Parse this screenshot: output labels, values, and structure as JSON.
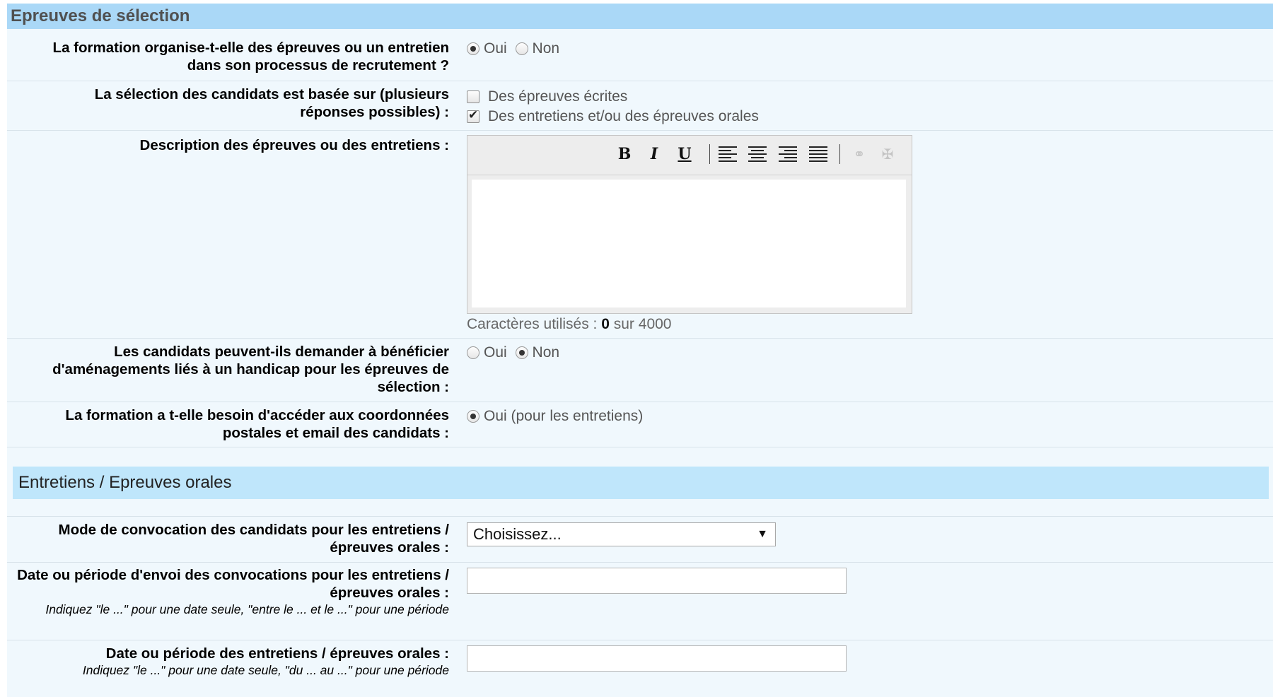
{
  "section": {
    "title": "Epreuves de sélection"
  },
  "q1": {
    "label": "La formation organise-t-elle des épreuves ou un entretien dans son processus de recrutement ?",
    "options": [
      "Oui",
      "Non"
    ],
    "selected": "Oui"
  },
  "q2": {
    "label": "La sélection des candidats est basée sur (plusieurs réponses possibles) :",
    "options": [
      {
        "label": "Des épreuves écrites",
        "checked": false
      },
      {
        "label": "Des entretiens et/ou des épreuves orales",
        "checked": true
      }
    ]
  },
  "q3": {
    "label": "Description des épreuves ou des entretiens :",
    "toolbar": [
      "bold-icon",
      "italic-icon",
      "underline-icon",
      "align-left-icon",
      "align-center-icon",
      "align-right-icon",
      "align-justify-icon",
      "link-icon",
      "unlink-icon"
    ],
    "counter_prefix": "Caractères utilisés : ",
    "counter_value": "0",
    "counter_suffix": " sur 4000"
  },
  "q4": {
    "label": "Les candidats peuvent-ils demander à bénéficier d'aménagements liés à un handicap pour les épreuves de sélection :",
    "options": [
      "Oui",
      "Non"
    ],
    "selected": "Non"
  },
  "q5": {
    "label": "La formation a t-elle besoin d'accéder aux coordonnées postales et email des candidats :",
    "option": "Oui (pour les entretiens)",
    "selected": true
  },
  "subsection": {
    "title": "Entretiens / Epreuves orales"
  },
  "q6": {
    "label": "Mode de convocation des candidats pour les entretiens / épreuves orales :",
    "select_value": "Choisissez..."
  },
  "q7": {
    "label": "Date ou période d'envoi des convocations pour les entretiens / épreuves orales :",
    "hint": "Indiquez \"le ...\" pour une date seule, \"entre le ... et le ...\" pour une période",
    "value": ""
  },
  "q8": {
    "label": "Date ou période des entretiens / épreuves orales :",
    "hint": "Indiquez \"le ...\" pour une date seule, \"du ... au ...\" pour une période",
    "value": ""
  }
}
